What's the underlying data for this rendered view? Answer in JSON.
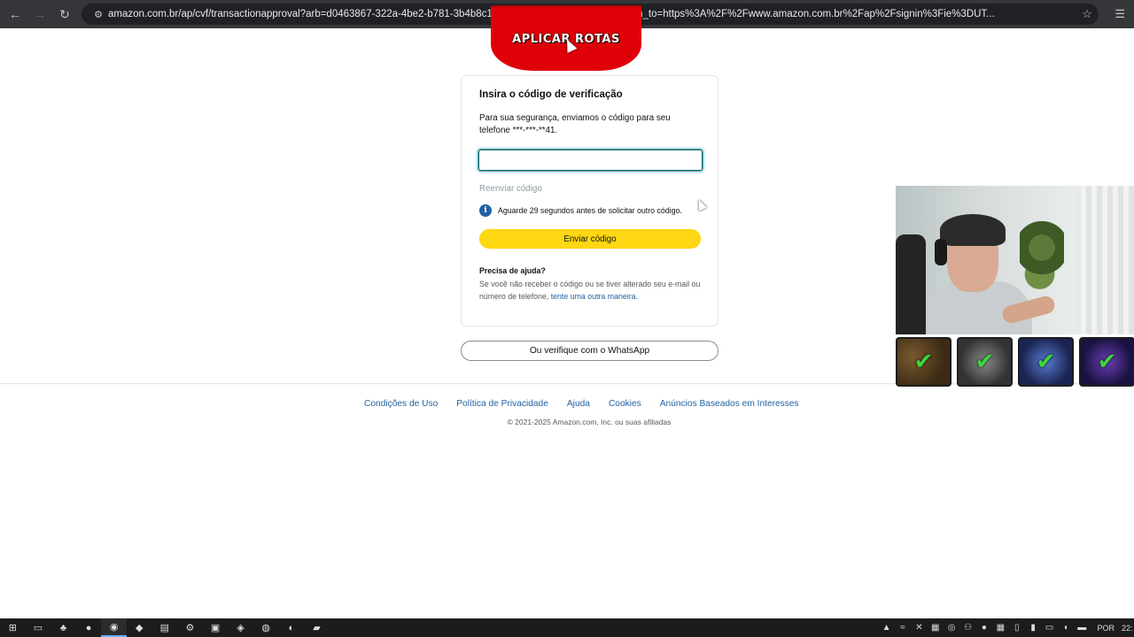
{
  "browser": {
    "back_icon": "←",
    "forward_icon": "→",
    "reload_icon": "↻",
    "site_info_icon": "⚙",
    "url": "amazon.com.br/ap/cvf/transactionapproval?arb=d0463867-322a-4be2-b781-3b4b8c13ccf48                         geId=brflex&openid.return_to=https%3A%2F%2Fwww.amazon.com.br%2Fap%2Fsignin%3Fie%3DUT...",
    "bookmark_icon": "☆",
    "menu_icon": "☰"
  },
  "overlay": {
    "badge_text": "APLICAR ROTAS",
    "badge_color": "#e00008"
  },
  "verification": {
    "title": "Insira o código de verificação",
    "description": "Para sua segurança, enviamos o código para seu telefone ***-***-**41.",
    "input_value": "",
    "resend_label": "Reenviar código",
    "info_icon": "i",
    "info_text": "Aguarde 29 segundos antes de solicitar outro código.",
    "submit_label": "Enviar código",
    "help_title": "Precisa de ajuda?",
    "help_text_before": "Se você não receber o código ou se tiver alterado seu e-mail ou número de telefone, ",
    "help_link": "tente uma outra maneira",
    "help_text_after": ".",
    "whatsapp_label": "Ou verifique com o WhatsApp"
  },
  "footer": {
    "links": [
      "Condições de Uso",
      "Política de Privacidade",
      "Ajuda",
      "Cookies",
      "Anúncios Baseados em Interesses"
    ],
    "copyright": "© 2021-2025 Amazon.com, Inc. ou suas afiliadas"
  },
  "achievements": {
    "check_icon": "✔"
  },
  "taskbar": {
    "icons": [
      "⊞",
      "▭",
      "♣",
      "●",
      "◉",
      "◆",
      "▤",
      "⚙",
      "▣",
      "◈",
      "◍",
      "◐",
      "▰"
    ],
    "tray_icons": [
      "▲",
      "≈",
      "✕",
      "▦",
      "◎",
      "⚇",
      "●",
      "▦",
      "▯",
      "▮",
      "▭",
      "◖",
      "▬"
    ],
    "language": "POR",
    "time": "22:"
  },
  "colors": {
    "amazon_yellow": "#ffd814",
    "link_blue": "#2162a1",
    "info_blue": "#2162a1"
  }
}
